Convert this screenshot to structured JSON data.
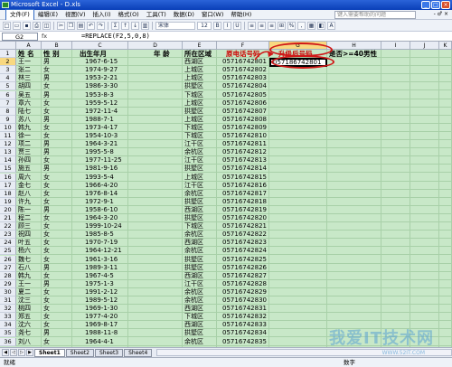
{
  "window": {
    "title": "Microsoft Excel - D.xls",
    "min": "_",
    "max": "□",
    "close": "×"
  },
  "menu": {
    "items": [
      "文件(F)",
      "编辑(E)",
      "视图(V)",
      "插入(I)",
      "格式(O)",
      "工具(T)",
      "数据(D)",
      "窗口(W)",
      "帮助(H)"
    ],
    "help_placeholder": "键入需要帮助的问题",
    "controls": "- ♂ ×"
  },
  "toolbar": {
    "font": "宋体",
    "size": "12",
    "buttons": [
      "B",
      "I",
      "U"
    ]
  },
  "formula": {
    "namebox": "G2",
    "fx": "fx",
    "text": "=REPLACE(F2,5,0,8)"
  },
  "columns": [
    "A",
    "B",
    "C",
    "D",
    "E",
    "F",
    "G",
    "H",
    "I",
    "J",
    "K"
  ],
  "headers": {
    "name": "姓 名",
    "sex": "性 别",
    "dob": "出生年月",
    "age": "年 龄",
    "district": "所在区域",
    "phone": "原电话号码",
    "upgraded": "升级后号码",
    "over40": "是否>=40男性"
  },
  "selected_value": "057186742801",
  "rows": [
    [
      "王一",
      "男",
      "1967-6-15",
      "西湖区",
      "05716742801"
    ],
    [
      "张二",
      "女",
      "1974-9-27",
      "上城区",
      "05716742802"
    ],
    [
      "林三",
      "男",
      "1953-2-21",
      "上城区",
      "05716742803"
    ],
    [
      "胡四",
      "女",
      "1986-3-30",
      "拱墅区",
      "05716742804"
    ],
    [
      "吴五",
      "男",
      "1953-8-3",
      "下城区",
      "05716742805"
    ],
    [
      "章六",
      "女",
      "1959-5-12",
      "上城区",
      "05716742806"
    ],
    [
      "陆七",
      "女",
      "1972-11-4",
      "拱墅区",
      "05716742807"
    ],
    [
      "苏八",
      "男",
      "1988-7-1",
      "上城区",
      "05716742808"
    ],
    [
      "韩九",
      "女",
      "1973-4-17",
      "下城区",
      "05716742809"
    ],
    [
      "徐一",
      "女",
      "1954-10-3",
      "下城区",
      "05716742810"
    ],
    [
      "项二",
      "男",
      "1964-3-21",
      "江干区",
      "05716742811"
    ],
    [
      "贾三",
      "男",
      "1995-5-8",
      "余杭区",
      "05716742812"
    ],
    [
      "孙四",
      "女",
      "1977-11-25",
      "江干区",
      "05716742813"
    ],
    [
      "施五",
      "男",
      "1981-9-16",
      "拱墅区",
      "05716742814"
    ],
    [
      "周六",
      "女",
      "1993-5-4",
      "上城区",
      "05716742815"
    ],
    [
      "金七",
      "女",
      "1966-4-20",
      "江干区",
      "05716742816"
    ],
    [
      "赵八",
      "女",
      "1976-8-14",
      "余杭区",
      "05716742817"
    ],
    [
      "许九",
      "女",
      "1972-9-1",
      "拱墅区",
      "05716742818"
    ],
    [
      "陈一",
      "男",
      "1958-6-10",
      "西湖区",
      "05716742819"
    ],
    [
      "程二",
      "女",
      "1964-3-20",
      "拱墅区",
      "05716742820"
    ],
    [
      "顾三",
      "女",
      "1999-10-24",
      "下城区",
      "05716742821"
    ],
    [
      "祝四",
      "女",
      "1985-8-5",
      "余杭区",
      "05716742822"
    ],
    [
      "叶五",
      "女",
      "1970-7-19",
      "西湖区",
      "05716742823"
    ],
    [
      "杨六",
      "女",
      "1964-12-21",
      "余杭区",
      "05716742824"
    ],
    [
      "魏七",
      "女",
      "1961-3-16",
      "拱墅区",
      "05716742825"
    ],
    [
      "石八",
      "男",
      "1989-3-11",
      "拱墅区",
      "05716742826"
    ],
    [
      "韩九",
      "女",
      "1967-4-5",
      "西湖区",
      "05716742827"
    ],
    [
      "王一",
      "男",
      "1975-1-3",
      "江干区",
      "05716742828"
    ],
    [
      "夏二",
      "女",
      "1991-2-12",
      "余杭区",
      "05716742829"
    ],
    [
      "沈三",
      "女",
      "1989-5-12",
      "余杭区",
      "05716742830"
    ],
    [
      "桃四",
      "女",
      "1969-1-30",
      "西湖区",
      "05716742831"
    ],
    [
      "郑五",
      "女",
      "1977-4-20",
      "下城区",
      "05716742832"
    ],
    [
      "沈六",
      "女",
      "1969-8-17",
      "西湖区",
      "05716742833"
    ],
    [
      "尧七",
      "男",
      "1988-11-8",
      "拱墅区",
      "05716742834"
    ],
    [
      "刘八",
      "女",
      "1964-4-1",
      "余杭区",
      "05716742835"
    ]
  ],
  "sheets": [
    "Sheet1",
    "Sheet2",
    "Sheet3",
    "Sheet4"
  ],
  "status": {
    "left": "就绪",
    "right": "数字"
  },
  "watermark": {
    "main": "我爱IT技术网",
    "sub": "WWW.52IT.COM"
  }
}
